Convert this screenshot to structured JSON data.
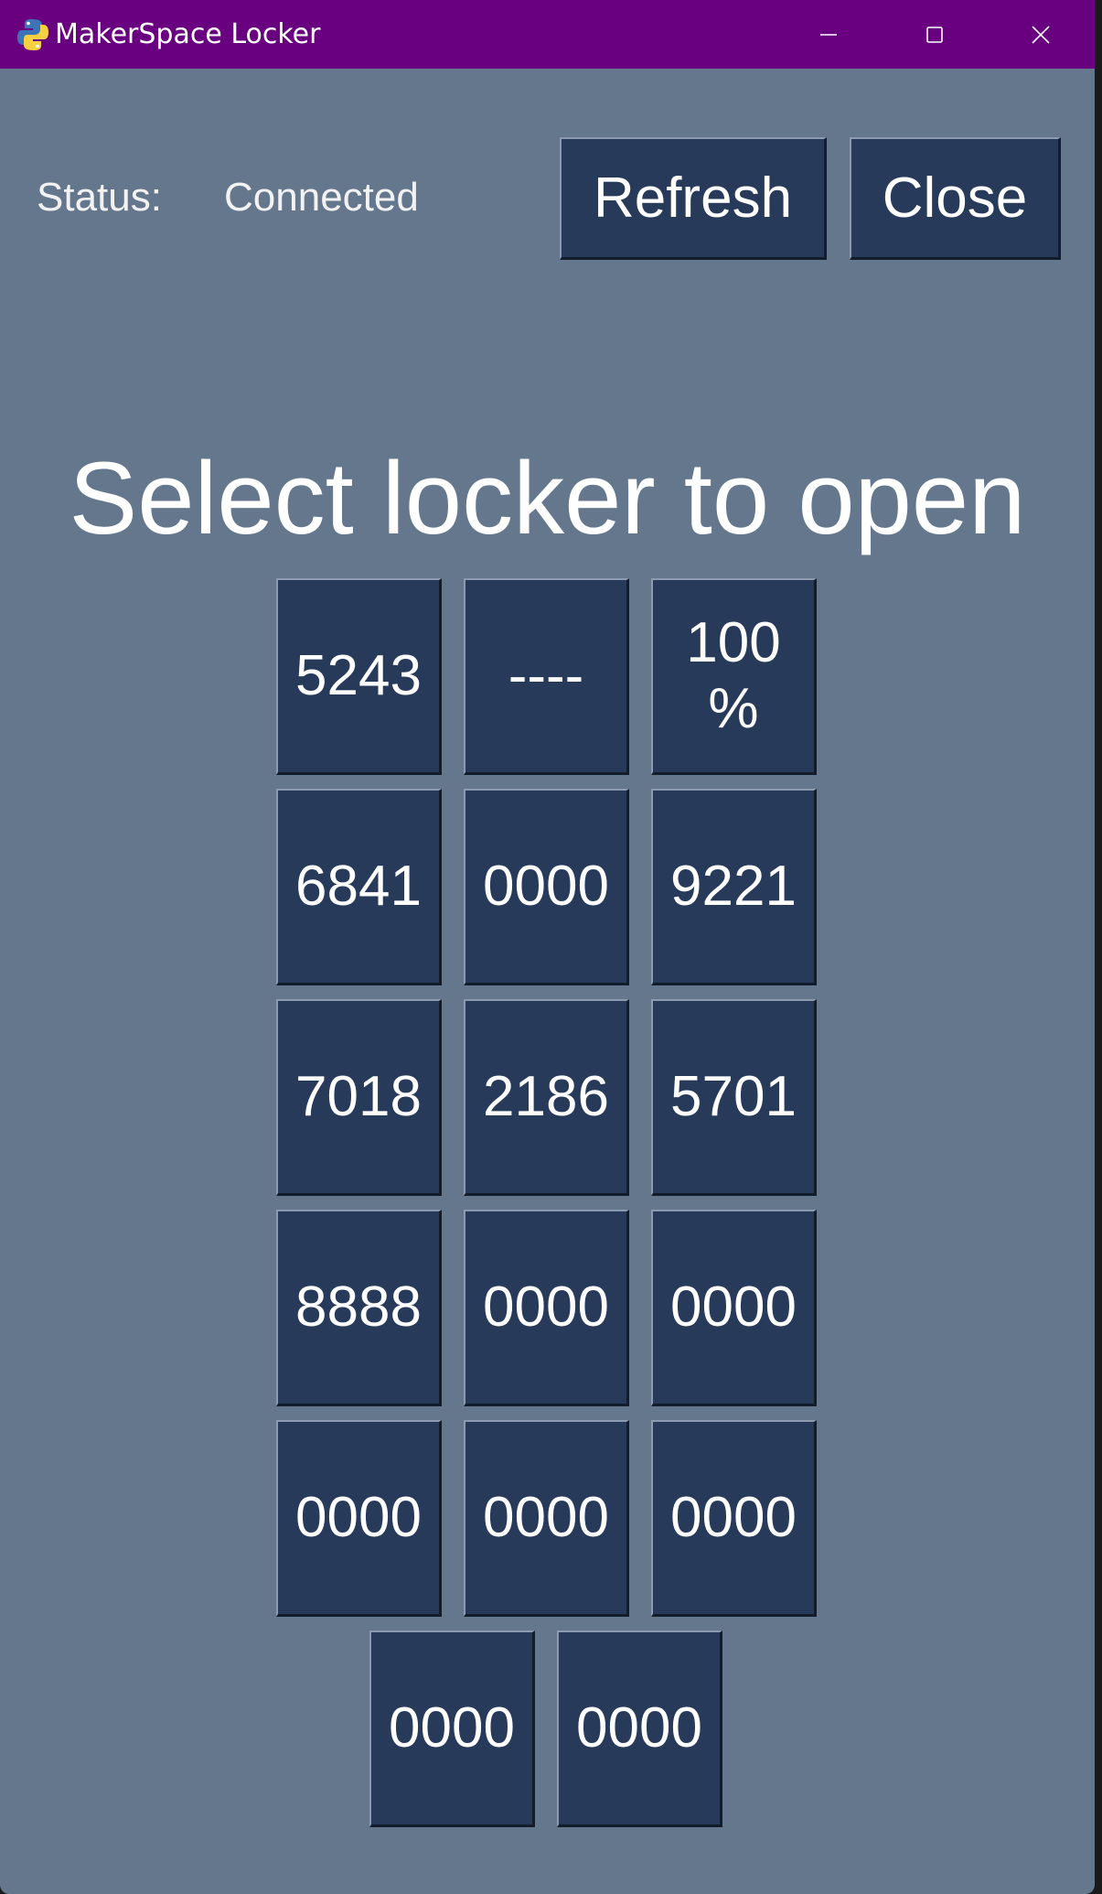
{
  "window": {
    "title": "MakerSpace Locker",
    "titlebar_color": "#680080",
    "background_color": "#64778d",
    "app_icon": "python-logo-icon",
    "controls": {
      "minimize_icon": "minimize-icon",
      "maximize_icon": "maximize-icon",
      "close_icon": "close-icon"
    }
  },
  "status": {
    "label": "Status:",
    "value": "Connected"
  },
  "toolbar": {
    "refresh_label": "Refresh",
    "close_label": "Close",
    "button_color": "#273a5a"
  },
  "heading": "Select locker to open",
  "lockers": [
    "5243",
    "----",
    "100 %",
    "6841",
    "0000",
    "9221",
    "7018",
    "2186",
    "5701",
    "8888",
    "0000",
    "0000",
    "0000",
    "0000",
    "0000",
    "0000",
    "0000"
  ]
}
